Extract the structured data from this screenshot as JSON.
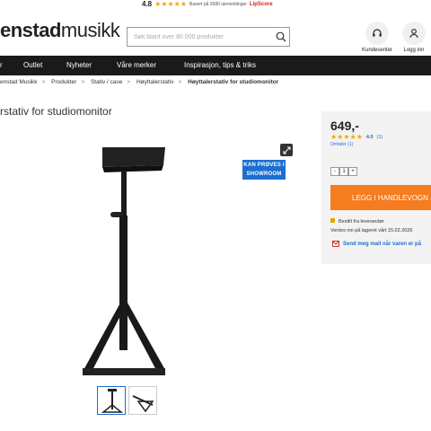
{
  "topbar": {
    "score": "4.8",
    "stars": "★★★★★",
    "based_on": "Basert på 2680 ulemeldinger",
    "lipscore": "LipScore"
  },
  "header": {
    "logo_part1": "enstad",
    "logo_part2": "musikk",
    "search_placeholder": "Søk blant over 80 000 produkter",
    "customer_service": "Kundesenter",
    "login": "Logg inn"
  },
  "nav": {
    "items": [
      "r",
      "Outlet",
      "Nyheter",
      "Våre merker",
      "Inspirasjon, tips & triks"
    ]
  },
  "breadcrumbs": [
    "enstad Musikk",
    "Produkter",
    "Stativ / case",
    "Høyttalerstativ",
    "Høyttalerstativ for studiomonitor"
  ],
  "product": {
    "title": "rstativ for studiomonitor",
    "badge_line1": "KAN PRØVES I",
    "badge_line2": "SHOWROOM"
  },
  "buybox": {
    "price": "649,-",
    "stars": "★★★★★",
    "rating": "4.0",
    "rating_count": "(1)",
    "reviews": "Omtaler (1)",
    "qty_minus": "-",
    "qty_value": "1",
    "qty_plus": "+",
    "cart_button": "LEGG I HANDLEVOGN",
    "stock_line1": "Bestilt fra leverandør",
    "stock_line2": "Ventes inn på lageret vårt 15.02.2026",
    "mail_link": "Send meg mail når varen er på"
  },
  "colors": {
    "nav_bg": "#1a1a1a",
    "accent_blue": "#1c6fd1",
    "cart_orange": "#f57c1f",
    "star_gold": "#f2a900"
  }
}
